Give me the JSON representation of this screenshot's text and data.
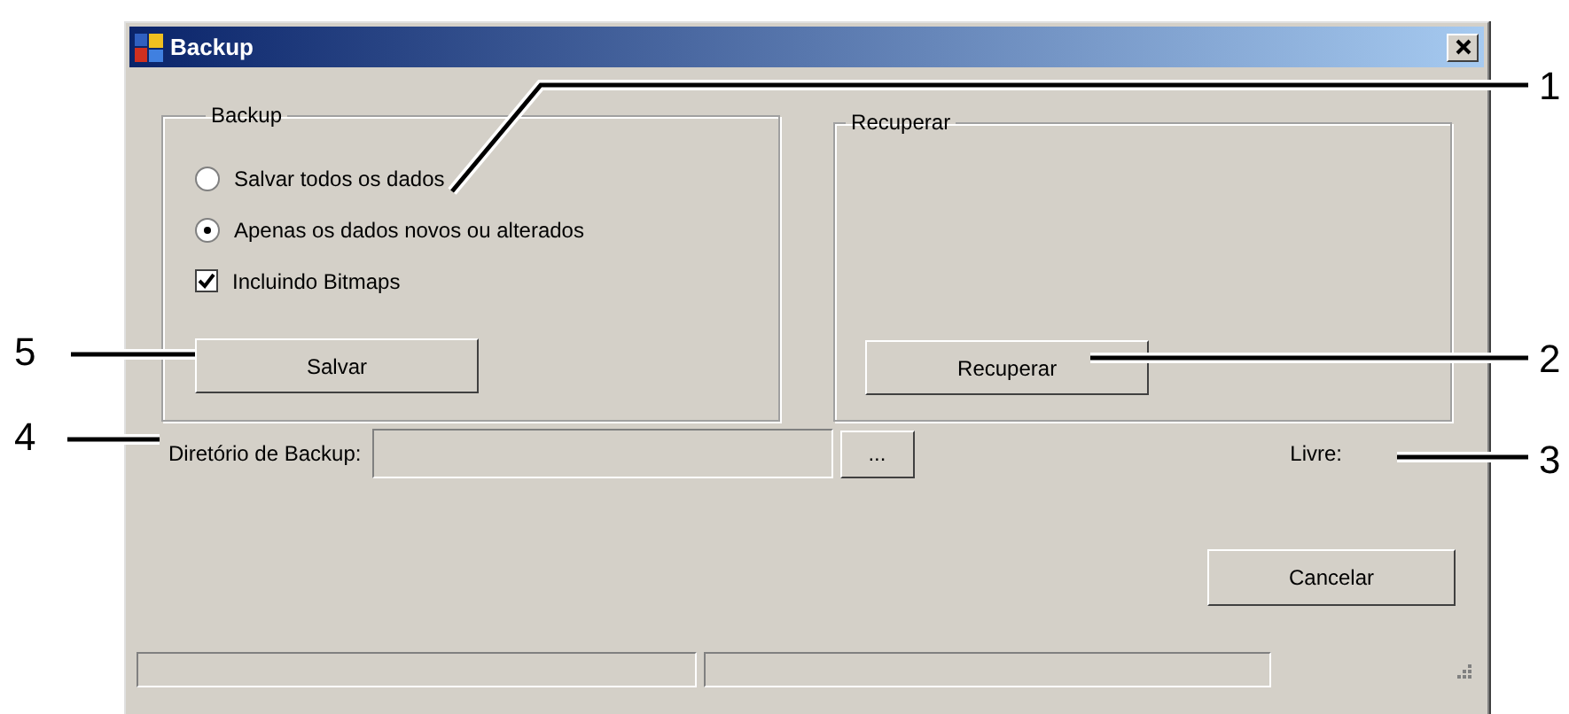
{
  "window": {
    "title": "Backup"
  },
  "backup_group": {
    "title": "Backup",
    "options": [
      {
        "label": "Salvar todos os dados",
        "selected": false
      },
      {
        "label": "Apenas os dados novos ou alterados",
        "selected": true
      }
    ],
    "include_bitmaps": {
      "label": "Incluindo Bitmaps",
      "checked": true
    },
    "button": "Salvar"
  },
  "restore_group": {
    "title": "Recuperar",
    "button": "Recuperar"
  },
  "directory": {
    "label": "Diretório de Backup:",
    "browse_button": "..."
  },
  "free_space": {
    "label": "Livre:"
  },
  "cancel_button": "Cancelar",
  "left_callouts": [
    {
      "number": "5"
    },
    {
      "number": "4"
    }
  ],
  "right_callouts": [
    {
      "number": "1"
    },
    {
      "number": "2"
    },
    {
      "number": "3"
    }
  ]
}
